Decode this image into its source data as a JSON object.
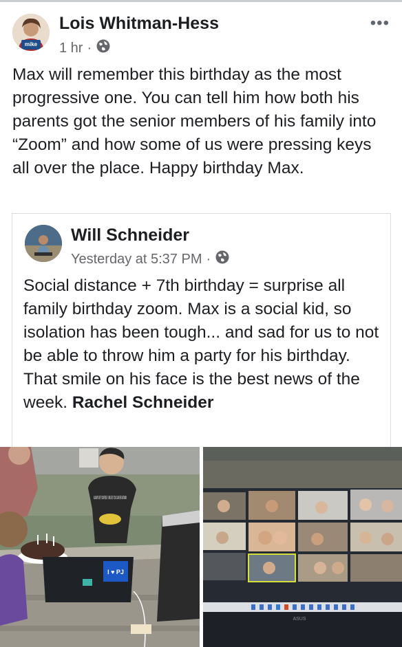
{
  "post": {
    "author": "Lois Whitman-Hess",
    "avatar_badge": "mike",
    "time": "1 hr",
    "dot": "·",
    "audience_icon": "globe-icon",
    "more_icon": "more-options-icon",
    "text": "Max will remember this birthday as the most progressive one. You can tell him how both his parents got the senior members of his family into “Zoom” and how some of us were pressing keys all over the place. Happy birthday Max."
  },
  "shared_post": {
    "author": "Will Schneider",
    "time": "Yesterday at 5:37 PM",
    "dot": "·",
    "audience_icon": "globe-icon",
    "text": "Social distance + 7th birthday = surprise all family birthday zoom. Max is a social kid, so isolation has been tough... and sad for us to not be able to throw him a party for his birthday. That smile on his face is the best news of the week.",
    "tagged": "Rachel Schneider"
  },
  "photos": {
    "left": {
      "shirt_text": "ALWAYS BE YOURSELF UNLESS YOU CAN BE BATMAN",
      "sticker_text": "I ♥ PJ"
    },
    "right": {
      "screen_brand": "ASUS"
    }
  },
  "colors": {
    "text": "#1c1e21",
    "meta": "#65676b",
    "border": "#dadde1"
  }
}
